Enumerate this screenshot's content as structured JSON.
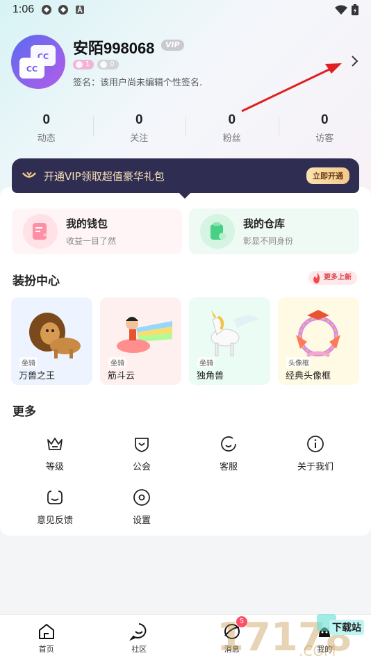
{
  "status_bar": {
    "time": "1:06"
  },
  "profile": {
    "username": "安陌998068",
    "vip_badge": "VIP",
    "level_pink": "1",
    "level_grey": "0",
    "signature": "签名：该用户尚未编辑个性签名."
  },
  "stats": [
    {
      "value": "0",
      "label": "动态"
    },
    {
      "value": "0",
      "label": "关注"
    },
    {
      "value": "0",
      "label": "粉丝"
    },
    {
      "value": "0",
      "label": "访客"
    }
  ],
  "vip_banner": {
    "text": "开通VIP领取超值豪华礼包",
    "button": "立即开通"
  },
  "cards": {
    "wallet": {
      "title": "我的钱包",
      "subtitle": "收益一目了然"
    },
    "warehouse": {
      "title": "我的仓库",
      "subtitle": "彰显不同身份"
    }
  },
  "decoration": {
    "title": "装扮中心",
    "more_new": "更多上新",
    "items": [
      {
        "type": "坐骑",
        "name": "万兽之王"
      },
      {
        "type": "坐骑",
        "name": "筋斗云"
      },
      {
        "type": "坐骑",
        "name": "独角兽"
      },
      {
        "type": "头像框",
        "name": "经典头像框"
      }
    ]
  },
  "more": {
    "title": "更多",
    "items": [
      {
        "label": "等级",
        "icon": "crown-icon"
      },
      {
        "label": "公会",
        "icon": "shield-icon"
      },
      {
        "label": "客服",
        "icon": "headset-icon"
      },
      {
        "label": "关于我们",
        "icon": "info-icon"
      },
      {
        "label": "意见反馈",
        "icon": "feedback-icon"
      },
      {
        "label": "设置",
        "icon": "settings-icon"
      }
    ]
  },
  "bottom_nav": {
    "items": [
      {
        "label": "首页",
        "icon": "home-icon"
      },
      {
        "label": "社区",
        "icon": "community-icon"
      },
      {
        "label": "消息",
        "icon": "message-icon",
        "badge": "5"
      },
      {
        "label": "我的",
        "icon": "profile-icon"
      }
    ]
  },
  "watermark": {
    "text": "下载站"
  },
  "colors": {
    "banner_bg": "#2f2e52",
    "accent_pink": "#ff4e6a",
    "gold_text": "#f7e2b8"
  }
}
